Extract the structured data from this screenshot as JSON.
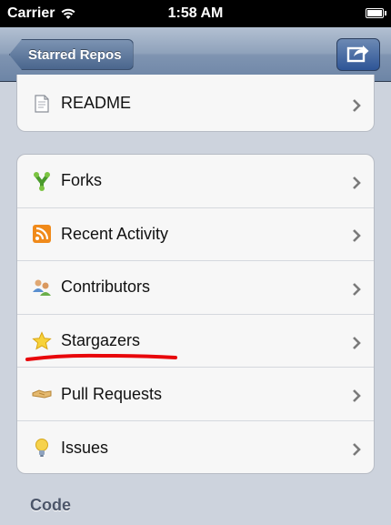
{
  "status_bar": {
    "carrier": "Carrier",
    "time": "1:58 AM"
  },
  "nav": {
    "back_label": "Starred Repos",
    "share_icon": "share-icon"
  },
  "top_group": {
    "items": [
      {
        "label": "README",
        "icon": "document-icon"
      }
    ]
  },
  "main_group": {
    "items": [
      {
        "label": "Forks",
        "icon": "fork-icon"
      },
      {
        "label": "Recent Activity",
        "icon": "rss-icon"
      },
      {
        "label": "Contributors",
        "icon": "people-icon"
      },
      {
        "label": "Stargazers",
        "icon": "star-icon"
      },
      {
        "label": "Pull Requests",
        "icon": "handshake-icon"
      },
      {
        "label": "Issues",
        "icon": "lightbulb-icon"
      }
    ]
  },
  "section": {
    "code_header": "Code"
  },
  "colors": {
    "nav_gradient_top": "#b3c0d2",
    "nav_gradient_bottom": "#6d85a6",
    "background": "#cdd3dd",
    "annotation": "#e8070b"
  }
}
